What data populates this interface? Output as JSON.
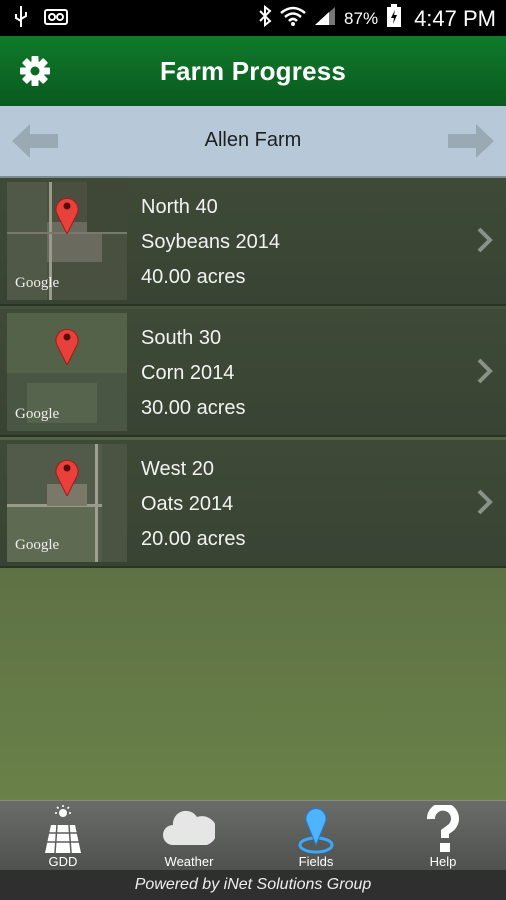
{
  "status_bar": {
    "battery": "87%",
    "time": "4:47 PM"
  },
  "header": {
    "title": "Farm Progress"
  },
  "farm_nav": {
    "farm_name": "Allen Farm"
  },
  "fields": [
    {
      "name": "North 40",
      "crop": "Soybeans 2014",
      "acres": "40.00 acres",
      "map_label": "Google"
    },
    {
      "name": "South 30",
      "crop": "Corn 2014",
      "acres": "30.00 acres",
      "map_label": "Google"
    },
    {
      "name": "West 20",
      "crop": "Oats 2014",
      "acres": "20.00 acres",
      "map_label": "Google"
    }
  ],
  "tabs": [
    {
      "label": "GDD",
      "icon": "gdd-icon"
    },
    {
      "label": "Weather",
      "icon": "cloud-icon"
    },
    {
      "label": "Fields",
      "icon": "location-pin-icon"
    },
    {
      "label": "Help",
      "icon": "question-icon"
    }
  ],
  "footer": {
    "text": "Powered by iNet Solutions Group"
  },
  "colors": {
    "header": "#0a5a1f",
    "nav": "#b7c9d8",
    "active_tab": "#4fb3ff"
  }
}
